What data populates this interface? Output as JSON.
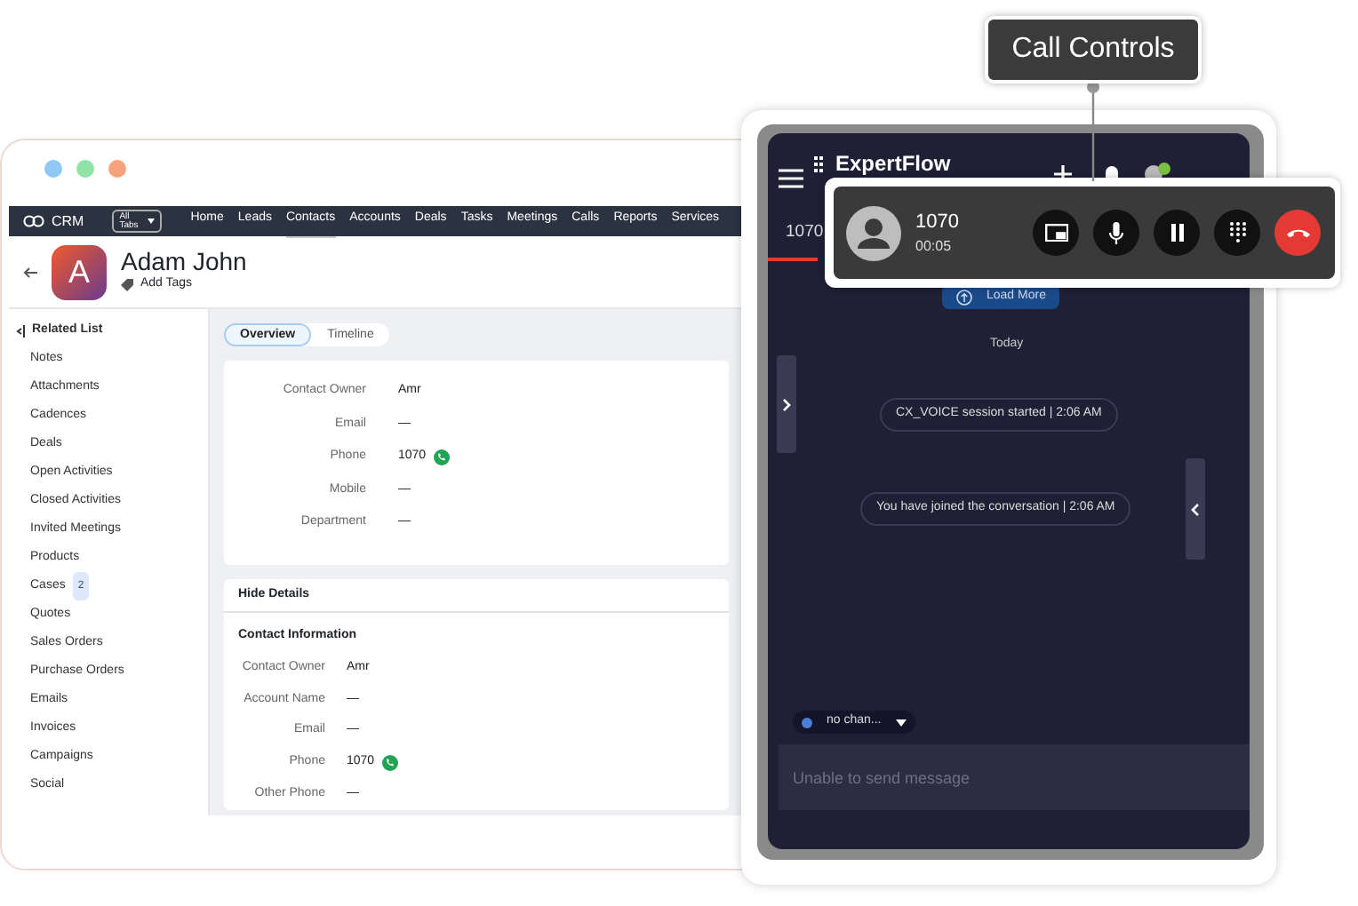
{
  "callout": {
    "label": "Call Controls"
  },
  "crm": {
    "app_name": "CRM",
    "tabs_menu": "All Tabs",
    "nav": [
      {
        "label": "Home",
        "selected": false
      },
      {
        "label": "Leads",
        "selected": false
      },
      {
        "label": "Contacts",
        "selected": true
      },
      {
        "label": "Accounts",
        "selected": false
      },
      {
        "label": "Deals",
        "selected": false
      },
      {
        "label": "Tasks",
        "selected": false
      },
      {
        "label": "Meetings",
        "selected": false
      },
      {
        "label": "Calls",
        "selected": false
      },
      {
        "label": "Reports",
        "selected": false
      },
      {
        "label": "Services",
        "selected": false
      }
    ],
    "contact": {
      "initial": "A",
      "name": "Adam John",
      "tags_link": "Add Tags"
    },
    "related_list": {
      "title": "Related List",
      "items": [
        {
          "label": "Notes"
        },
        {
          "label": "Attachments"
        },
        {
          "label": "Cadences"
        },
        {
          "label": "Deals"
        },
        {
          "label": "Open Activities"
        },
        {
          "label": "Closed Activities"
        },
        {
          "label": "Invited Meetings"
        },
        {
          "label": "Products"
        },
        {
          "label": "Cases",
          "count": "2"
        },
        {
          "label": "Quotes"
        },
        {
          "label": "Sales Orders"
        },
        {
          "label": "Purchase Orders"
        },
        {
          "label": "Emails"
        },
        {
          "label": "Invoices"
        },
        {
          "label": "Campaigns"
        },
        {
          "label": "Social"
        }
      ]
    },
    "view_tabs": [
      {
        "label": "Overview",
        "selected": true
      },
      {
        "label": "Timeline",
        "selected": false
      }
    ],
    "overview_fields": [
      {
        "label": "Contact Owner",
        "value": "Amr"
      },
      {
        "label": "Email",
        "value": "—"
      },
      {
        "label": "Phone",
        "value": "1070",
        "kind": "phone"
      },
      {
        "label": "Mobile",
        "value": "—"
      },
      {
        "label": "Department",
        "value": "—"
      }
    ],
    "details": {
      "toggle": "Hide Details",
      "section": "Contact Information",
      "fields": [
        {
          "label": "Contact Owner",
          "value": "Amr"
        },
        {
          "label": "Account Name",
          "value": "—"
        },
        {
          "label": "Email",
          "value": "—"
        },
        {
          "label": "Phone",
          "value": "1070",
          "kind": "phone"
        },
        {
          "label": "Other Phone",
          "value": "—"
        }
      ]
    }
  },
  "agent_panel": {
    "brand": "ExpertFlow",
    "tab": "1070",
    "load_more": "Load More",
    "date": "Today",
    "messages": [
      "CX_VOICE session started | 2:06 AM",
      "You have joined the conversation | 2:06 AM"
    ],
    "channel": "no chan...",
    "composer": {
      "placeholder": "Unable to send message"
    }
  },
  "call_bar": {
    "caller": "1070",
    "duration": "00:05",
    "buttons": [
      {
        "kind": "pip"
      },
      {
        "kind": "mic"
      },
      {
        "kind": "hold"
      },
      {
        "kind": "dialpad"
      },
      {
        "kind": "end"
      }
    ]
  }
}
